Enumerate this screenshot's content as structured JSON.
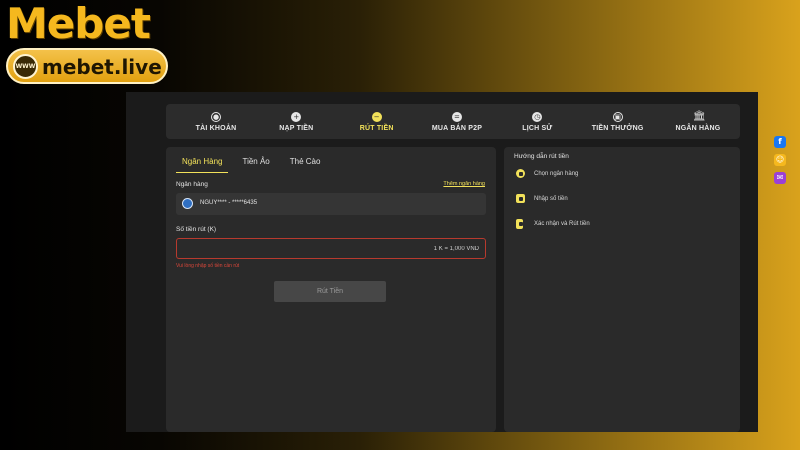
{
  "brand": {
    "wordmark": "Mebet",
    "globe_text": "WWW",
    "url": "mebet.live"
  },
  "nav": [
    {
      "label": "TÀI KHOẢN",
      "icon": "user-icon"
    },
    {
      "label": "NẠP TIỀN",
      "icon": "plus-circle-icon"
    },
    {
      "label": "RÚT TIỀN",
      "icon": "minus-circle-icon",
      "active": true
    },
    {
      "label": "MUA BÁN P2P",
      "icon": "exchange-icon"
    },
    {
      "label": "LỊCH SỬ",
      "icon": "clock-icon"
    },
    {
      "label": "TIỀN THƯỞNG",
      "icon": "gift-icon"
    },
    {
      "label": "NGÂN HÀNG",
      "icon": "bank-icon"
    }
  ],
  "withdraw": {
    "tabs": [
      {
        "label": "Ngân Hàng",
        "active": true
      },
      {
        "label": "Tiền Ảo"
      },
      {
        "label": "Thẻ Cào"
      }
    ],
    "bank_label": "Ngân hàng",
    "add_bank_link": "Thêm ngân hàng",
    "bank_account": "NGUY**** - *****6435",
    "amount_label": "Số tiền rút (K)",
    "amount_placeholder": "1 K = 1,000 VND",
    "error_text": "Vui lòng nhập số tiền cần rút",
    "submit_label": "Rút Tiền"
  },
  "guide": {
    "title": "Hướng dẫn rút tiền",
    "steps": [
      {
        "text": "Chọn ngân hàng",
        "icon": "bank-check-icon"
      },
      {
        "text": "Nhập số tiền",
        "icon": "money-icon"
      },
      {
        "text": "Xác nhận và Rút tiền",
        "icon": "phone-confirm-icon"
      }
    ]
  },
  "social": [
    {
      "icon": "facebook-icon",
      "glyph": "f",
      "color": "#1877f2"
    },
    {
      "icon": "support-icon",
      "glyph": "☺",
      "color": "#f5b81e"
    },
    {
      "icon": "messenger-icon",
      "glyph": "✉",
      "color": "#9b3fd6"
    }
  ],
  "colors": {
    "accent": "#f2e15a",
    "error": "#d9473a",
    "panel": "#2a2a2a"
  }
}
